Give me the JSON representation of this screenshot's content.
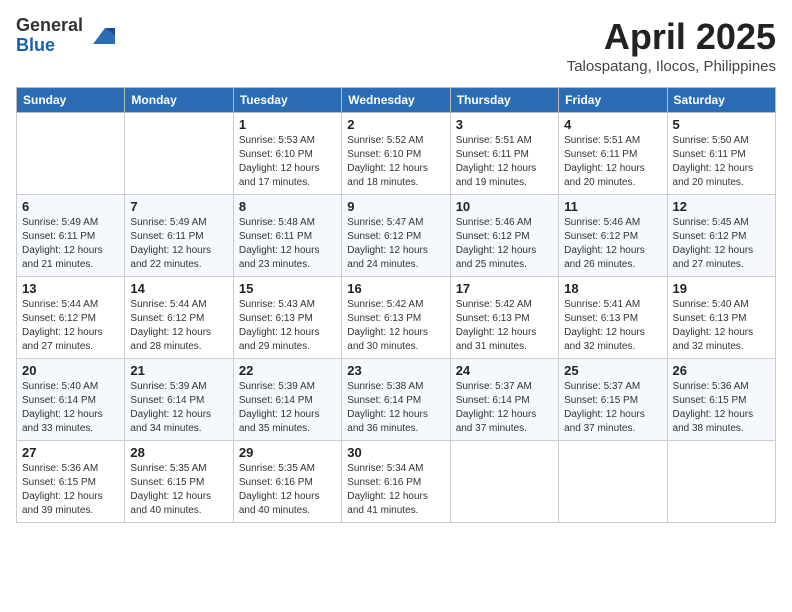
{
  "header": {
    "logo_general": "General",
    "logo_blue": "Blue",
    "month_title": "April 2025",
    "location": "Talospatang, Ilocos, Philippines"
  },
  "days_of_week": [
    "Sunday",
    "Monday",
    "Tuesday",
    "Wednesday",
    "Thursday",
    "Friday",
    "Saturday"
  ],
  "weeks": [
    [
      {
        "day": "",
        "sunrise": "",
        "sunset": "",
        "daylight": ""
      },
      {
        "day": "",
        "sunrise": "",
        "sunset": "",
        "daylight": ""
      },
      {
        "day": "1",
        "sunrise": "Sunrise: 5:53 AM",
        "sunset": "Sunset: 6:10 PM",
        "daylight": "Daylight: 12 hours and 17 minutes."
      },
      {
        "day": "2",
        "sunrise": "Sunrise: 5:52 AM",
        "sunset": "Sunset: 6:10 PM",
        "daylight": "Daylight: 12 hours and 18 minutes."
      },
      {
        "day": "3",
        "sunrise": "Sunrise: 5:51 AM",
        "sunset": "Sunset: 6:11 PM",
        "daylight": "Daylight: 12 hours and 19 minutes."
      },
      {
        "day": "4",
        "sunrise": "Sunrise: 5:51 AM",
        "sunset": "Sunset: 6:11 PM",
        "daylight": "Daylight: 12 hours and 20 minutes."
      },
      {
        "day": "5",
        "sunrise": "Sunrise: 5:50 AM",
        "sunset": "Sunset: 6:11 PM",
        "daylight": "Daylight: 12 hours and 20 minutes."
      }
    ],
    [
      {
        "day": "6",
        "sunrise": "Sunrise: 5:49 AM",
        "sunset": "Sunset: 6:11 PM",
        "daylight": "Daylight: 12 hours and 21 minutes."
      },
      {
        "day": "7",
        "sunrise": "Sunrise: 5:49 AM",
        "sunset": "Sunset: 6:11 PM",
        "daylight": "Daylight: 12 hours and 22 minutes."
      },
      {
        "day": "8",
        "sunrise": "Sunrise: 5:48 AM",
        "sunset": "Sunset: 6:11 PM",
        "daylight": "Daylight: 12 hours and 23 minutes."
      },
      {
        "day": "9",
        "sunrise": "Sunrise: 5:47 AM",
        "sunset": "Sunset: 6:12 PM",
        "daylight": "Daylight: 12 hours and 24 minutes."
      },
      {
        "day": "10",
        "sunrise": "Sunrise: 5:46 AM",
        "sunset": "Sunset: 6:12 PM",
        "daylight": "Daylight: 12 hours and 25 minutes."
      },
      {
        "day": "11",
        "sunrise": "Sunrise: 5:46 AM",
        "sunset": "Sunset: 6:12 PM",
        "daylight": "Daylight: 12 hours and 26 minutes."
      },
      {
        "day": "12",
        "sunrise": "Sunrise: 5:45 AM",
        "sunset": "Sunset: 6:12 PM",
        "daylight": "Daylight: 12 hours and 27 minutes."
      }
    ],
    [
      {
        "day": "13",
        "sunrise": "Sunrise: 5:44 AM",
        "sunset": "Sunset: 6:12 PM",
        "daylight": "Daylight: 12 hours and 27 minutes."
      },
      {
        "day": "14",
        "sunrise": "Sunrise: 5:44 AM",
        "sunset": "Sunset: 6:12 PM",
        "daylight": "Daylight: 12 hours and 28 minutes."
      },
      {
        "day": "15",
        "sunrise": "Sunrise: 5:43 AM",
        "sunset": "Sunset: 6:13 PM",
        "daylight": "Daylight: 12 hours and 29 minutes."
      },
      {
        "day": "16",
        "sunrise": "Sunrise: 5:42 AM",
        "sunset": "Sunset: 6:13 PM",
        "daylight": "Daylight: 12 hours and 30 minutes."
      },
      {
        "day": "17",
        "sunrise": "Sunrise: 5:42 AM",
        "sunset": "Sunset: 6:13 PM",
        "daylight": "Daylight: 12 hours and 31 minutes."
      },
      {
        "day": "18",
        "sunrise": "Sunrise: 5:41 AM",
        "sunset": "Sunset: 6:13 PM",
        "daylight": "Daylight: 12 hours and 32 minutes."
      },
      {
        "day": "19",
        "sunrise": "Sunrise: 5:40 AM",
        "sunset": "Sunset: 6:13 PM",
        "daylight": "Daylight: 12 hours and 32 minutes."
      }
    ],
    [
      {
        "day": "20",
        "sunrise": "Sunrise: 5:40 AM",
        "sunset": "Sunset: 6:14 PM",
        "daylight": "Daylight: 12 hours and 33 minutes."
      },
      {
        "day": "21",
        "sunrise": "Sunrise: 5:39 AM",
        "sunset": "Sunset: 6:14 PM",
        "daylight": "Daylight: 12 hours and 34 minutes."
      },
      {
        "day": "22",
        "sunrise": "Sunrise: 5:39 AM",
        "sunset": "Sunset: 6:14 PM",
        "daylight": "Daylight: 12 hours and 35 minutes."
      },
      {
        "day": "23",
        "sunrise": "Sunrise: 5:38 AM",
        "sunset": "Sunset: 6:14 PM",
        "daylight": "Daylight: 12 hours and 36 minutes."
      },
      {
        "day": "24",
        "sunrise": "Sunrise: 5:37 AM",
        "sunset": "Sunset: 6:14 PM",
        "daylight": "Daylight: 12 hours and 37 minutes."
      },
      {
        "day": "25",
        "sunrise": "Sunrise: 5:37 AM",
        "sunset": "Sunset: 6:15 PM",
        "daylight": "Daylight: 12 hours and 37 minutes."
      },
      {
        "day": "26",
        "sunrise": "Sunrise: 5:36 AM",
        "sunset": "Sunset: 6:15 PM",
        "daylight": "Daylight: 12 hours and 38 minutes."
      }
    ],
    [
      {
        "day": "27",
        "sunrise": "Sunrise: 5:36 AM",
        "sunset": "Sunset: 6:15 PM",
        "daylight": "Daylight: 12 hours and 39 minutes."
      },
      {
        "day": "28",
        "sunrise": "Sunrise: 5:35 AM",
        "sunset": "Sunset: 6:15 PM",
        "daylight": "Daylight: 12 hours and 40 minutes."
      },
      {
        "day": "29",
        "sunrise": "Sunrise: 5:35 AM",
        "sunset": "Sunset: 6:16 PM",
        "daylight": "Daylight: 12 hours and 40 minutes."
      },
      {
        "day": "30",
        "sunrise": "Sunrise: 5:34 AM",
        "sunset": "Sunset: 6:16 PM",
        "daylight": "Daylight: 12 hours and 41 minutes."
      },
      {
        "day": "",
        "sunrise": "",
        "sunset": "",
        "daylight": ""
      },
      {
        "day": "",
        "sunrise": "",
        "sunset": "",
        "daylight": ""
      },
      {
        "day": "",
        "sunrise": "",
        "sunset": "",
        "daylight": ""
      }
    ]
  ]
}
